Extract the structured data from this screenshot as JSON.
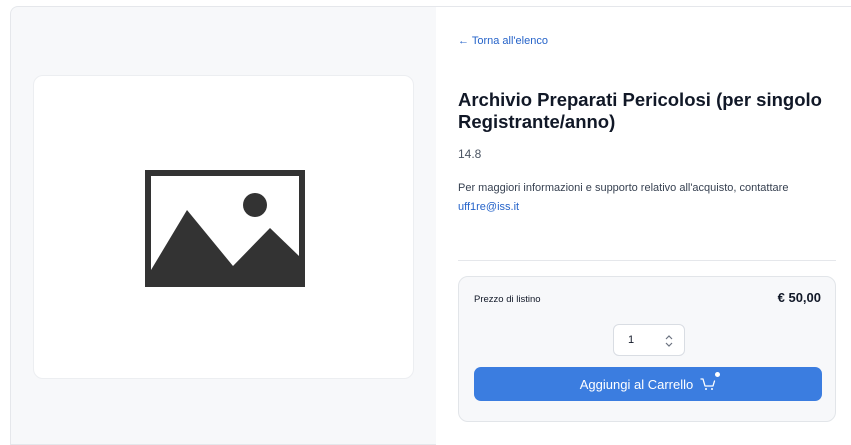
{
  "navigation": {
    "back_label": "← Torna all'elenco"
  },
  "product": {
    "title": "Archivio Preparati Pericolosi (per singolo Registrante/anno)",
    "code": "14.8",
    "info_prefix": "Per maggiori informazioni e supporto relativo all'acquisto, contattare",
    "contact_email": "uff1re@iss.it",
    "image_icon": "image-placeholder-icon"
  },
  "purchase": {
    "price_label": "Prezzo di listino",
    "price_value": "€ 50,00",
    "quantity": "1",
    "add_to_cart_label": "Aggiungi al Carrello",
    "cart_icon": "cart-icon"
  },
  "colors": {
    "accent": "#3b7de0",
    "link": "#2563c9",
    "panel_bg": "#f7f8fa"
  }
}
